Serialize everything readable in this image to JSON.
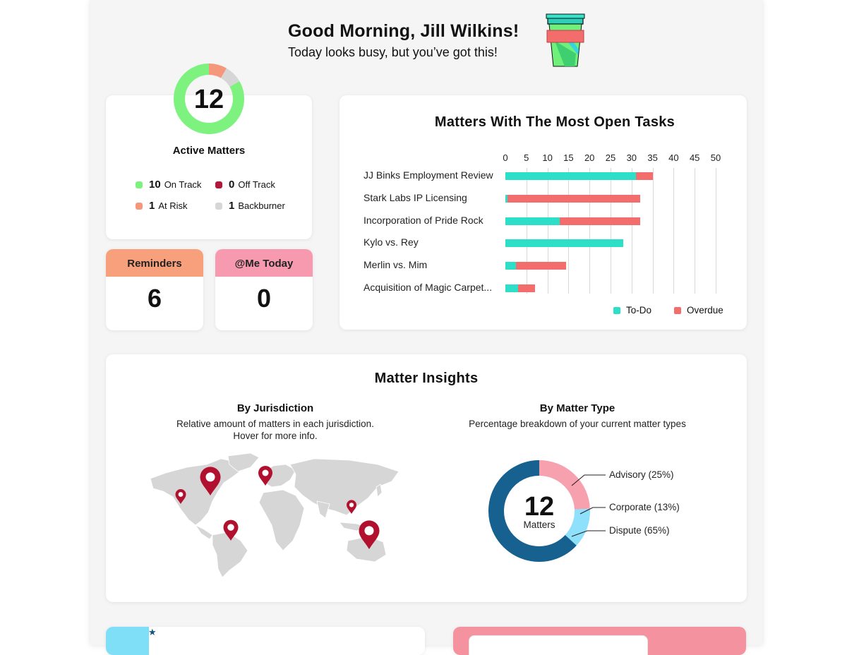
{
  "greeting": {
    "title": "Good Morning, Jill Wilkins!",
    "subtitle": "Today looks busy, but you’ve got this!"
  },
  "active_matters": {
    "count": "12",
    "label": "Active Matters",
    "legend": [
      {
        "count": "10",
        "label": "On Track",
        "color": "#7ef27e"
      },
      {
        "count": "0",
        "label": "Off Track",
        "color": "#b4173a"
      },
      {
        "count": "1",
        "label": "At Risk",
        "color": "#f4977b"
      },
      {
        "count": "1",
        "label": "Backburner",
        "color": "#d6d6d6"
      }
    ],
    "ring_values": {
      "on_track": 10,
      "at_risk": 1,
      "backburner": 1,
      "off_track": 0
    }
  },
  "tiles": {
    "reminders": {
      "label": "Reminders",
      "value": "6",
      "color": "#f8a07c"
    },
    "me_today": {
      "label": "@Me Today",
      "value": "0",
      "color": "#f79ab0"
    }
  },
  "chart_data": {
    "type": "bar",
    "orientation": "horizontal-stacked",
    "title": "Matters With The Most Open Tasks",
    "xlim": [
      0,
      50
    ],
    "ticks": [
      "0",
      "5",
      "10",
      "15",
      "20",
      "25",
      "30",
      "35",
      "40",
      "45",
      "50"
    ],
    "categories": [
      "JJ Binks Employment Review",
      "Stark Labs IP Licensing",
      "Incorporation of Pride Rock",
      "Kylo vs. Rey",
      "Merlin vs. Mim",
      "Acquisition of Magic Carpet..."
    ],
    "series": [
      {
        "name": "To-Do",
        "color": "#2edfc8",
        "values": [
          31,
          0.5,
          13,
          28,
          2.5,
          3
        ]
      },
      {
        "name": "Overdue",
        "color": "#f26d6b",
        "values": [
          4,
          31.5,
          19,
          0,
          12,
          4
        ]
      }
    ],
    "legend_position": "bottom-right",
    "grid": true
  },
  "insights": {
    "title": "Matter Insights",
    "jurisdiction": {
      "title": "By Jurisdiction",
      "desc_line1": "Relative amount of matters in each jurisdiction.",
      "desc_line2": "Hover for more info."
    },
    "matter_type": {
      "title": "By Matter Type",
      "desc": "Percentage breakdown of your current matter types",
      "center_value": "12",
      "center_label": "Matters",
      "slices": [
        {
          "label": "Advisory (25%)",
          "value": 25,
          "color": "#f7a0ae"
        },
        {
          "label": "Corporate (13%)",
          "value": 13,
          "color": "#8fe0fb"
        },
        {
          "label": "Dispute (65%)",
          "value": 65,
          "color": "#16618f"
        }
      ]
    },
    "map_color": "#d6d6d6",
    "pin_color": "#b1112f"
  }
}
